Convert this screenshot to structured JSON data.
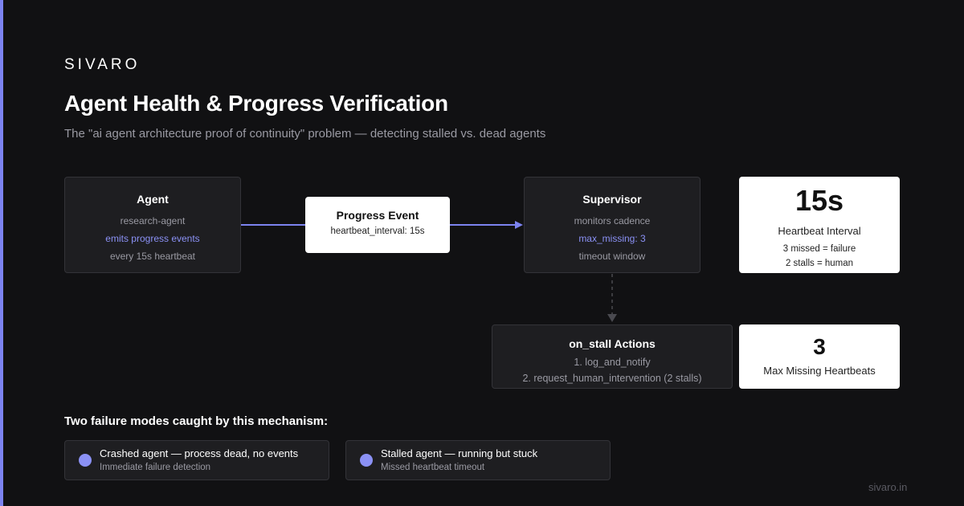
{
  "brand": "SIVARO",
  "title": "Agent Health & Progress Verification",
  "subtitle": "The \"ai agent architecture proof of continuity\" problem — detecting stalled vs. dead agents",
  "colors": {
    "background": "#111113",
    "accent": "#8b91f5",
    "accent_bar": "#7c83f0",
    "card_dark": "#1e1e21",
    "card_light": "#ffffff",
    "muted_text": "#9a9aa3"
  },
  "diagram": {
    "agent": {
      "title": "Agent",
      "lines": [
        "research-agent",
        "emits progress events",
        "every 15s heartbeat"
      ]
    },
    "progress_event": {
      "title": "Progress Event",
      "detail": "heartbeat_interval: 15s"
    },
    "supervisor": {
      "title": "Supervisor",
      "lines": [
        "monitors cadence",
        "max_missing: 3",
        "timeout window"
      ]
    },
    "on_stall": {
      "title": "on_stall Actions",
      "lines": [
        "1. log_and_notify",
        "2. request_human_intervention (2 stalls)"
      ]
    }
  },
  "stats": {
    "heartbeat": {
      "value": "15s",
      "label": "Heartbeat Interval",
      "notes": [
        "3 missed = failure",
        "2 stalls = human"
      ]
    },
    "max_missing": {
      "value": "3",
      "label": "Max Missing Heartbeats"
    }
  },
  "failure_modes": {
    "heading": "Two failure modes caught by this mechanism:",
    "items": [
      {
        "title": "Crashed agent — process dead, no events",
        "subtitle": "Immediate failure detection"
      },
      {
        "title": "Stalled agent — running but stuck",
        "subtitle": "Missed heartbeat timeout"
      }
    ]
  },
  "footer": {
    "url": "sivaro.in"
  }
}
